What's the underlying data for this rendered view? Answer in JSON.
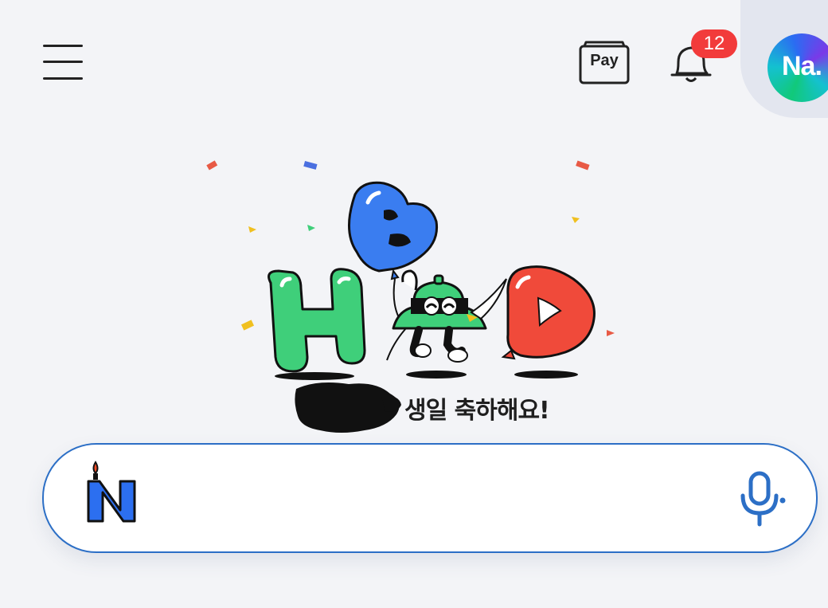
{
  "header": {
    "menu_icon": "hamburger-menu-icon",
    "pay_label": "Pay",
    "notification_icon": "bell-icon",
    "notification_count": "12",
    "avatar_text": "Na."
  },
  "doodle": {
    "balloon_letters": [
      "H",
      "B",
      "D"
    ],
    "colors": {
      "green": "#3fcf7a",
      "blue": "#3a7df0",
      "red": "#f04a3a",
      "accent": "#2c6fc6"
    }
  },
  "greeting": {
    "message": "생일 축하해요!"
  },
  "search": {
    "logo_letter": "N",
    "placeholder": "",
    "value": "",
    "mic_icon": "microphone-icon"
  }
}
